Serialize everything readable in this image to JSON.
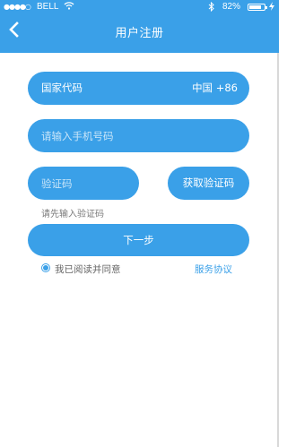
{
  "status_bar": {
    "signal_dots": "●●●●○",
    "carrier": "BELL",
    "battery_pct": "82%",
    "battery_level": 0.82
  },
  "header": {
    "title": "用户注册"
  },
  "form": {
    "country_label": "国家代码",
    "country_value": "中国 +86",
    "phone_placeholder": "请输入手机号码",
    "code_placeholder": "验证码",
    "get_code_label": "获取验证码",
    "code_hint": "请先输入验证码",
    "next_label": "下一步"
  },
  "agreement": {
    "text": "我已阅读并同意",
    "link": "服务协议",
    "checked": true
  },
  "colors": {
    "accent": "#3aa0e8"
  }
}
